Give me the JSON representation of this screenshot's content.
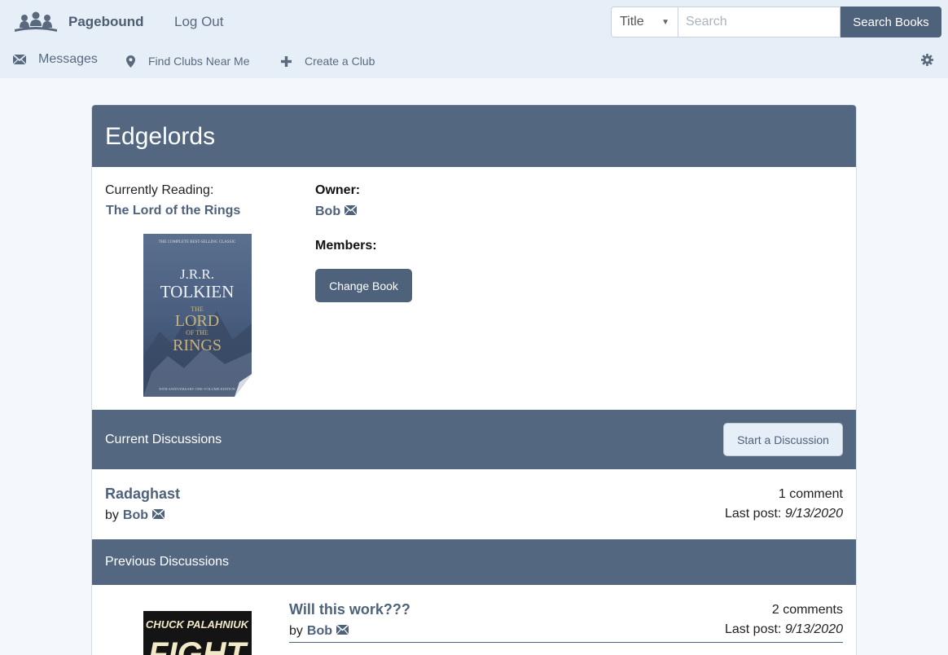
{
  "nav": {
    "brand": "Pagebound",
    "logout": "Log Out",
    "search_type": "Title",
    "search_placeholder": "Search",
    "search_button": "Search Books",
    "messages": "Messages",
    "find_clubs": "Find Clubs Near Me",
    "create_club": "Create a Club"
  },
  "club": {
    "name": "Edgelords",
    "reading_label": "Currently Reading:",
    "reading_title": "The Lord of the Rings",
    "owner_label": "Owner:",
    "owner_name": "Bob",
    "members_label": "Members:",
    "change_book": "Change Book",
    "cover": {
      "top_line": "THE COMPLETE BEST-SELLING CLASSIC",
      "author_line1": "J.R.R.",
      "author_line2": "TOLKIEN",
      "title_line1": "THE",
      "title_line2": "LORD",
      "title_line3": "OF THE",
      "title_line4": "RINGS",
      "bottom_line": "50TH ANNIVERSARY ONE-VOLUME EDITION"
    }
  },
  "current": {
    "heading": "Current Discussions",
    "start_button": "Start a Discussion",
    "items": [
      {
        "title": "Radaghast",
        "by": "by",
        "author": "Bob",
        "comments": "1 comment",
        "last_label": "Last post:",
        "last_date": "9/13/2020"
      }
    ]
  },
  "previous": {
    "heading": "Previous Discussions",
    "items": [
      {
        "title": "Will this work???",
        "by": "by",
        "author": "Bob",
        "comments": "2 comments",
        "last_label": "Last post:",
        "last_date": "9/13/2020",
        "cover_author": "CHUCK PALAHNIUK",
        "cover_title": "FIGHT"
      }
    ]
  },
  "colors": {
    "primary": "#536880",
    "nav_bg": "#e6eef7",
    "link": "#4e627c"
  }
}
